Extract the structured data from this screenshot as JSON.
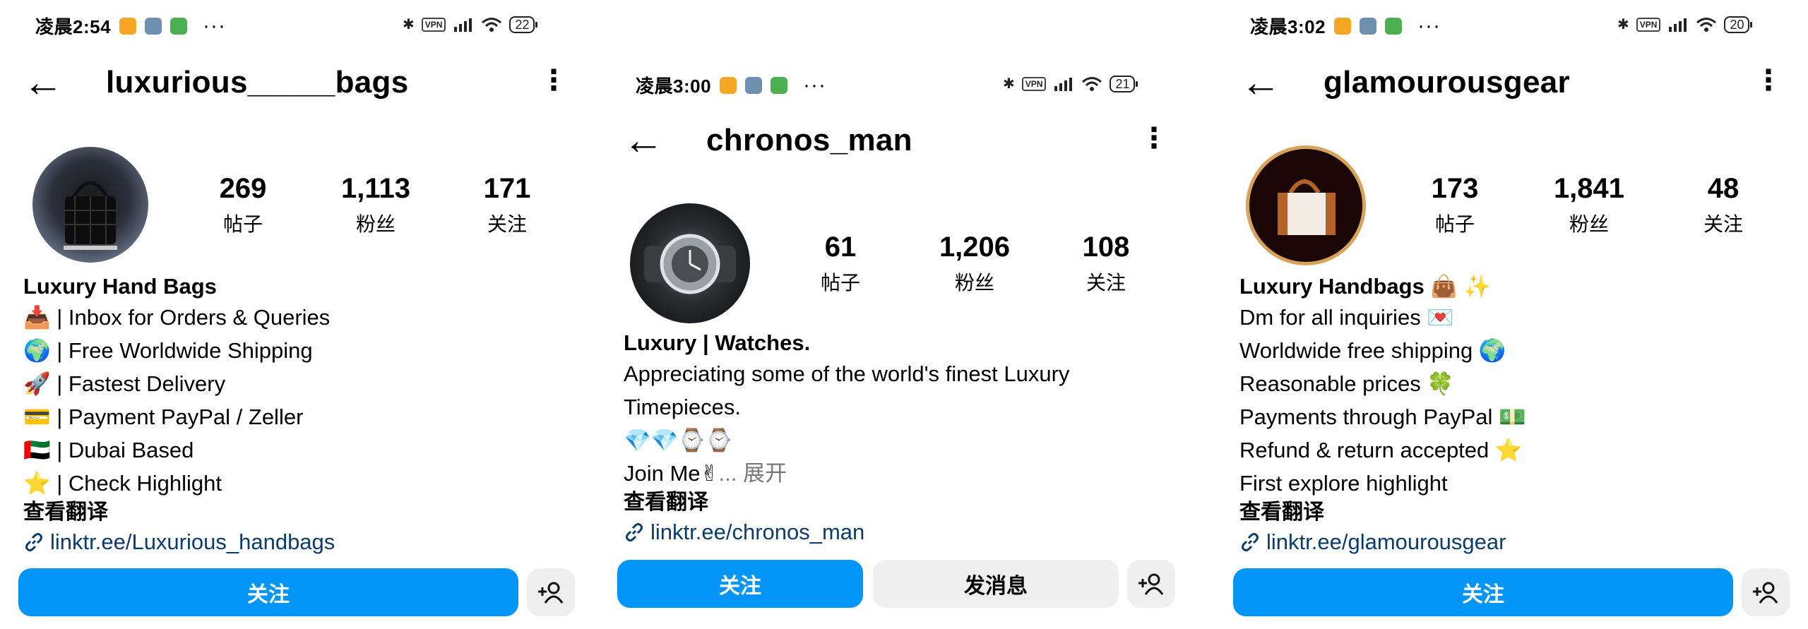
{
  "panels": [
    {
      "status": {
        "time": "凌晨2:54",
        "battery": "22",
        "vpn": "VPN"
      },
      "username": "luxurious_____bags",
      "stats": [
        {
          "num": "269",
          "label": "帖子"
        },
        {
          "num": "1,113",
          "label": "粉丝"
        },
        {
          "num": "171",
          "label": "关注"
        }
      ],
      "bio_name": "Luxury Hand Bags",
      "bio_lines": [
        "📥 | Inbox for Orders & Queries",
        "🌍 | Free Worldwide Shipping",
        "🚀 | Fastest Delivery",
        "💳 | Payment PayPal / Zeller",
        "🇦🇪 | Dubai Based",
        "⭐ | Check Highlight"
      ],
      "translate": "查看翻译",
      "link": "linktr.ee/Luxurious_handbags",
      "follow_label": "关注"
    },
    {
      "status": {
        "time": "凌晨3:00",
        "battery": "21",
        "vpn": "VPN"
      },
      "username": "chronos_man",
      "stats": [
        {
          "num": "61",
          "label": "帖子"
        },
        {
          "num": "1,206",
          "label": "粉丝"
        },
        {
          "num": "108",
          "label": "关注"
        }
      ],
      "bio_name": "Luxury | Watches.",
      "bio_lines": [
        "Appreciating some of the world's finest Luxury",
        "Timepieces.",
        "💎💎⌚⌚"
      ],
      "bio_last": "Join Me✌",
      "bio_more": "... 展开",
      "translate": "查看翻译",
      "link": "linktr.ee/chronos_man",
      "follow_label": "关注",
      "message_label": "发消息"
    },
    {
      "status": {
        "time": "凌晨3:02",
        "battery": "20",
        "vpn": "VPN"
      },
      "username": "glamourousgear",
      "stats": [
        {
          "num": "173",
          "label": "帖子"
        },
        {
          "num": "1,841",
          "label": "粉丝"
        },
        {
          "num": "48",
          "label": "关注"
        }
      ],
      "bio_name": "Luxury Handbags 👜 ✨",
      "bio_lines": [
        "Dm for all inquiries 💌",
        "Worldwide free shipping 🌍",
        "Reasonable prices 🍀",
        "Payments through PayPal 💵",
        "Refund & return accepted ⭐",
        "First explore highlight"
      ],
      "translate": "查看翻译",
      "link": "linktr.ee/glamourousgear",
      "follow_label": "关注"
    }
  ],
  "icons": [
    "back-arrow-icon",
    "more-options-icon",
    "link-icon",
    "add-person-icon",
    "bluetooth-icon",
    "signal-icon",
    "wifi-icon",
    "battery-icon"
  ],
  "colors": {
    "follow_blue": "#0095f6",
    "link_blue": "#0b3c6e",
    "secondary_gray": "#efefef"
  }
}
